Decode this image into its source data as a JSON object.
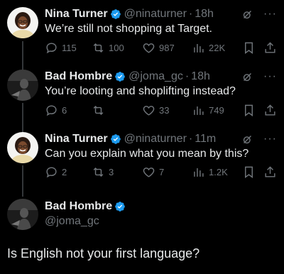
{
  "tweets": [
    {
      "name": "Nina Turner",
      "handle": "@ninaturner",
      "time": "18h",
      "text": "We’re still not shopping at Target.",
      "replies": "115",
      "retweets": "100",
      "likes": "987",
      "views": "22K"
    },
    {
      "name": "Bad Hombre",
      "handle": "@joma_gc",
      "time": "18h",
      "text": "You’re looting and shoplifting instead?",
      "replies": "6",
      "retweets": "",
      "likes": "33",
      "views": "749"
    },
    {
      "name": "Nina Turner",
      "handle": "@ninaturner",
      "time": "11m",
      "text": "Can you explain what you mean by this?",
      "replies": "2",
      "retweets": "3",
      "likes": "7",
      "views": "1.2K"
    }
  ],
  "main_tweet": {
    "name": "Bad Hombre",
    "handle": "@joma_gc",
    "text": "Is English not your first language?"
  },
  "colors": {
    "background": "#000000",
    "text": "#e7e9ea",
    "muted": "#71767b",
    "verified": "#1d9bf0"
  }
}
